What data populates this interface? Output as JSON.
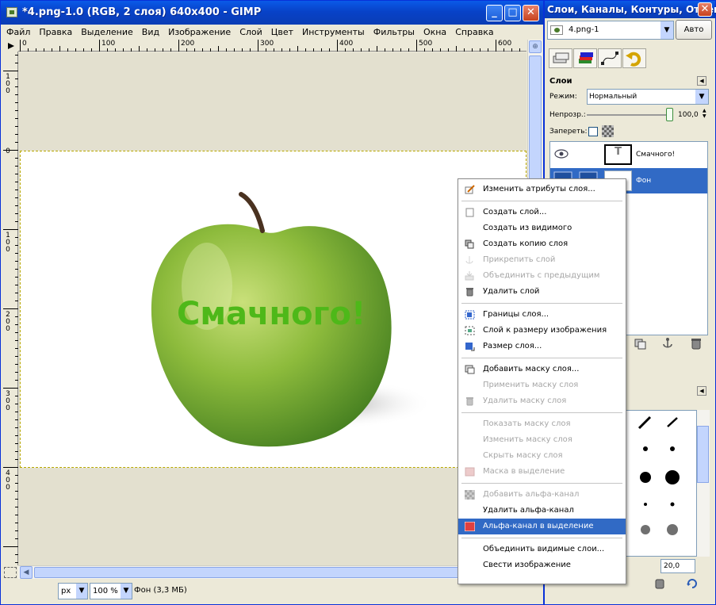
{
  "main_window": {
    "title": "*4.png-1.0 (RGB, 2 слоя) 640x400 - GIMP",
    "menus": [
      "Файл",
      "Правка",
      "Выделение",
      "Вид",
      "Изображение",
      "Слой",
      "Цвет",
      "Инструменты",
      "Фильтры",
      "Окна",
      "Справка"
    ],
    "ruler_top_labels": [
      "0",
      "100",
      "200",
      "300",
      "400",
      "500",
      "600"
    ],
    "ruler_left_labels": [
      "1\n0\n0",
      "0",
      "1\n0\n0",
      "2\n0\n0",
      "3\n0\n0",
      "4\n0\n0"
    ],
    "canvas_text": "Смачного!",
    "status": {
      "unit": "px",
      "zoom": "100 %",
      "info": "Фон (3,3 МБ)"
    }
  },
  "dock": {
    "title": "Слои, Каналы, Контуры, Отмени...",
    "image_selector": "4.png-1",
    "auto_button": "Авто",
    "layers_panel": {
      "title": "Слои",
      "mode_label": "Режим:",
      "mode_value": "Нормальный",
      "opacity_label": "Непрозр.:",
      "opacity_value": "100,0",
      "lock_label": "Запереть:",
      "layers": [
        {
          "name": "Смачного!",
          "selected": false
        },
        {
          "name": "Фон",
          "selected": true
        }
      ]
    },
    "brushes_panel": {
      "spacing_value": "20,0"
    }
  },
  "context_menu": {
    "items": [
      {
        "label": "Изменить атрибуты слоя...",
        "disabled": false,
        "icon": "edit-icon"
      },
      {
        "sep": true
      },
      {
        "label": "Создать слой...",
        "disabled": false,
        "icon": "new-layer-icon"
      },
      {
        "label": "Создать из видимого",
        "disabled": false,
        "icon": ""
      },
      {
        "label": "Создать копию слоя",
        "disabled": false,
        "icon": "duplicate-icon"
      },
      {
        "label": "Прикрепить слой",
        "disabled": true,
        "icon": "anchor-icon"
      },
      {
        "label": "Объединить с предыдущим",
        "disabled": true,
        "icon": "merge-down-icon"
      },
      {
        "label": "Удалить слой",
        "disabled": false,
        "icon": "trash-icon"
      },
      {
        "sep": true
      },
      {
        "label": "Границы слоя...",
        "disabled": false,
        "icon": "layer-boundary-icon"
      },
      {
        "label": "Слой к размеру изображения",
        "disabled": false,
        "icon": "layer-to-image-size-icon"
      },
      {
        "label": "Размер слоя...",
        "disabled": false,
        "icon": "scale-layer-icon"
      },
      {
        "sep": true
      },
      {
        "label": "Добавить маску слоя...",
        "disabled": false,
        "icon": "add-mask-icon"
      },
      {
        "label": "Применить маску слоя",
        "disabled": true,
        "icon": ""
      },
      {
        "label": "Удалить маску слоя",
        "disabled": true,
        "icon": "trash-icon"
      },
      {
        "sep": true
      },
      {
        "label": "Показать маску слоя",
        "disabled": true,
        "icon": ""
      },
      {
        "label": "Изменить маску слоя",
        "disabled": true,
        "icon": ""
      },
      {
        "label": "Скрыть маску слоя",
        "disabled": true,
        "icon": ""
      },
      {
        "label": "Маска в выделение",
        "disabled": true,
        "icon": "mask-to-selection-icon"
      },
      {
        "sep": true
      },
      {
        "label": "Добавить альфа-канал",
        "disabled": true,
        "icon": "alpha-icon"
      },
      {
        "label": "Удалить альфа-канал",
        "disabled": false,
        "icon": ""
      },
      {
        "label": "Альфа-канал в выделение",
        "disabled": false,
        "highlighted": true,
        "icon": "alpha-to-selection-icon"
      },
      {
        "sep": true
      },
      {
        "label": "Объединить видимые слои...",
        "disabled": false,
        "icon": ""
      },
      {
        "label": "Свести изображение",
        "disabled": false,
        "icon": ""
      }
    ]
  }
}
